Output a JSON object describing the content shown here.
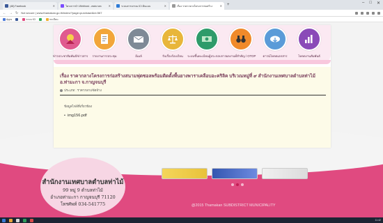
{
  "browser": {
    "tabs": [
      {
        "title": "(48) Facebook",
        "color": "#3b5998",
        "active": false
      },
      {
        "title": "โครงการนำ Webhost - เทศบาลต",
        "color": "#7b4cff",
        "active": false
      },
      {
        "title": "ระบบสารบรรณ ICI ต้นแบบ",
        "color": "#2e7bd6",
        "active": false
      },
      {
        "title": "เรื่อง ราคากลางโครงการก่อสร้าง",
        "color": "#999999",
        "active": true
      }
    ],
    "new_tab": "+",
    "window_controls": [
      "–",
      "□",
      "✕"
    ],
    "url": "Not secure | www.thamakan.go.th/index/?page=purchase&id=567",
    "bookmarks": [
      {
        "label": "Apps",
        "color": "#4a79d8"
      },
      {
        "label": "",
        "color": "#3b5998"
      },
      {
        "label": "ระบบ ICI",
        "color": "#e04a80"
      },
      {
        "label": "",
        "color": "#2eaa5a"
      },
      {
        "label": "ทะเบียน",
        "color": "#f0b030"
      }
    ]
  },
  "menu": [
    {
      "label": "ข่าวประชาสัมพันธ์/ข่าวสาร",
      "icon": "thai-emblem-icon",
      "color": "#e05a8f"
    },
    {
      "label": "รายงานการประชุม",
      "icon": "document-icon",
      "color": "#f2a63a"
    },
    {
      "label": "อีเมล์",
      "icon": "mail-icon",
      "color": "#7e8a96"
    },
    {
      "label": "รับเรื่องร้องเรียน",
      "icon": "scales-icon",
      "color": "#e8b63a"
    },
    {
      "label": "ระบบขึ้นทะเบียนผู้ประกอบการ",
      "icon": "money-icon",
      "color": "#2e9b6a"
    },
    {
      "label": "ผลงานที่สำคัญ / OTOP",
      "icon": "binoculars-icon",
      "color": "#f08a2a"
    },
    {
      "label": "ดาวน์โหลดเอกสาร",
      "icon": "cloud-download-icon",
      "color": "#5a9bd8"
    },
    {
      "label": "โหลดงานสัมพันธ์",
      "icon": "bar-chart-icon",
      "color": "#8a4ab8"
    }
  ],
  "article": {
    "title": "เรื่อง ราคากลางโครงการก่อสร้างสนามฟุตซอลพร้อมติดตั้งพื้นยางพาราเคลือบอะคริลิค บริเวณหมู่ที่ ๙ สำนักงานเทศบาลตำบลท่าไม้ อ.ท่ามะกา จ.กาญจนบุรี",
    "category": "ประเภท : ราคากลาง/จัดจ้าง",
    "attachments_heading": "ข้อมูลไฟล์ที่เกี่ยวข้อง",
    "attachments": [
      "img156.pdf"
    ]
  },
  "footer": {
    "org_name": "สำนักงานเทศบาลตำบลท่าไม้",
    "address_lines": [
      "99 หมู่ 9 ตำบลท่าไม้",
      "อำเภอท่ามะกา กาญจนบุรี 71120",
      "โทรศัพท์ 034-541775"
    ],
    "copyright": "@2015 Thamakan SUBDISTRICT MUNICIPALITY",
    "banner_colors": [
      "#f4d65a",
      "#4a6fc8",
      "#e8e8e8"
    ]
  },
  "taskbar": {
    "items": [
      "#3a7bd5",
      "#e8a33a",
      "#d9d9d9",
      "#2e9b5a",
      "#d84a4a"
    ],
    "clock": "11:42"
  }
}
